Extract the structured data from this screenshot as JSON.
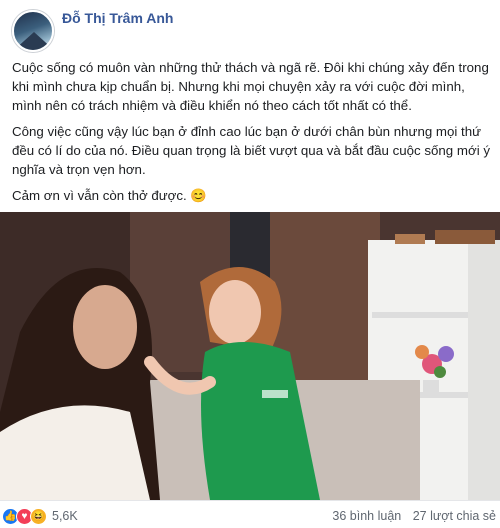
{
  "post": {
    "author": "Đỗ Thị Trâm Anh",
    "paragraphs": [
      "Cuộc sống có muôn vàn những thử thách và ngã rẽ. Đôi khi chúng xảy đến trong khi mình chưa kịp chuẩn bị. Nhưng khi mọi chuyện xảy ra với cuộc đời mình, mình nên có trách nhiệm và điều khiển nó theo cách tốt nhất có thể.",
      "Công việc cũng vậy lúc bạn ở đỉnh cao lúc bạn ở dưới chân bùn nhưng mọi thứ đều có lí do của nó. Điều quan trọng là biết vượt qua và bắt đầu cuộc sống mới ý nghĩa và trọn vẹn hơn.",
      "Cảm ơn vì vẫn còn thở được. 😊"
    ]
  },
  "footer": {
    "reaction_count": "5,6K",
    "comments": "36 bình luận",
    "shares": "27 lượt chia sẻ"
  },
  "icons": {
    "like": "like-icon",
    "love": "love-icon",
    "haha": "haha-icon"
  },
  "colors": {
    "author": "#385898",
    "like": "#1877f2",
    "love": "#f33e58",
    "haha": "#f7b125",
    "uniform": "#1e9a4e"
  }
}
